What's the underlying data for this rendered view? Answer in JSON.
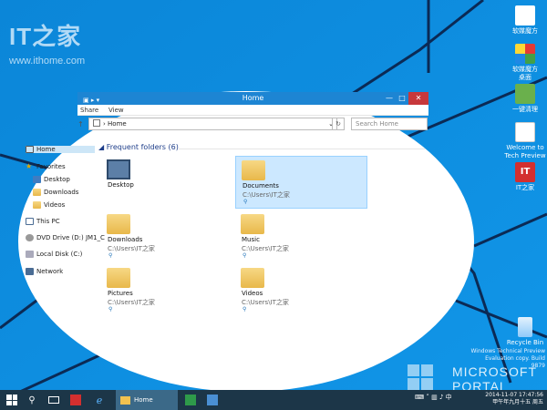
{
  "watermark": {
    "logo": "IT之家",
    "url": "www.ithome.com"
  },
  "desktop_icons": [
    {
      "label": "软媒魔方"
    },
    {
      "label": "软媒魔方\n桌面"
    },
    {
      "label": "一键清理"
    },
    {
      "label": "Welcome to\nTech Preview"
    },
    {
      "label": "IT之家"
    },
    {
      "label": "Recycle Bin"
    }
  ],
  "window": {
    "title": "Home",
    "ribbon_tabs": [
      "Share",
      "View"
    ],
    "address": "Home",
    "search_placeholder": "Search Home",
    "controls": [
      "—",
      "□",
      "✕"
    ]
  },
  "sidebar": {
    "items": [
      "Home",
      "Favorites",
      "Desktop",
      "Downloads",
      "Videos",
      "This PC",
      "DVD Drive (D:) JM1_C",
      "Local Disk (C:)",
      "Network"
    ]
  },
  "content": {
    "section_title": "Frequent folders (6)",
    "folders": [
      {
        "name": "Desktop",
        "path": ""
      },
      {
        "name": "Documents",
        "path": "C:\\Users\\IT之家"
      },
      {
        "name": "Downloads",
        "path": "C:\\Users\\IT之家"
      },
      {
        "name": "Music",
        "path": "C:\\Users\\IT之家"
      },
      {
        "name": "Pictures",
        "path": "C:\\Users\\IT之家"
      },
      {
        "name": "Videos",
        "path": "C:\\Users\\IT之家"
      }
    ]
  },
  "taskbar": {
    "explorer_label": "Home",
    "ime": "中"
  },
  "clock": {
    "time": "2014-11-07 17:47:56",
    "day": "甲午年九月十五 周五"
  },
  "portal": {
    "line1": "MICROSOFT",
    "line2": "PORTAL"
  },
  "build_text": {
    "line1": "Windows Technical Preview",
    "line2": "Evaluation copy. Build 9879"
  }
}
